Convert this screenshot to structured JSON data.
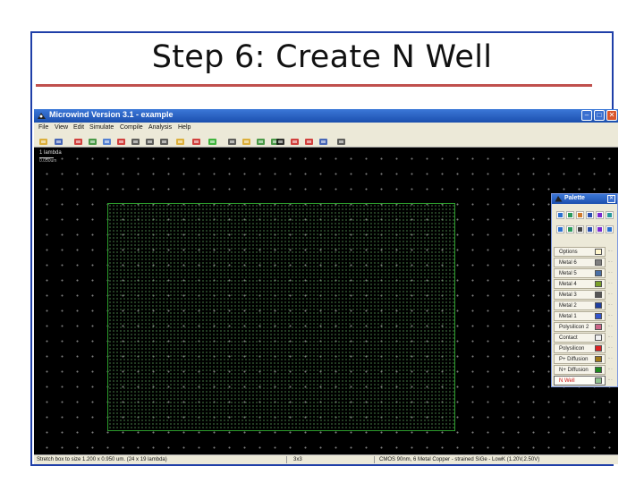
{
  "slide": {
    "title": "Step 6: Create N Well"
  },
  "app": {
    "window_title": "Microwind Version 3.1 - example",
    "menu": [
      "File",
      "View",
      "Edit",
      "Simulate",
      "Compile",
      "Analysis",
      "Help"
    ],
    "toolbar_icons": [
      {
        "name": "open-folder-icon",
        "color": "#d9a520"
      },
      {
        "name": "save-icon",
        "color": "#2a4fb0"
      },
      {
        "name": "draw-box-icon",
        "color": "#cc2222"
      },
      {
        "name": "stretch-icon",
        "color": "#2e8b2e"
      },
      {
        "name": "copy-icon",
        "color": "#3a6fd0"
      },
      {
        "name": "cut-icon",
        "color": "#cc2222"
      },
      {
        "name": "zoom-in-icon",
        "color": "#444444"
      },
      {
        "name": "zoom-out-icon",
        "color": "#444444"
      },
      {
        "name": "zoom-fit-icon",
        "color": "#444444"
      },
      {
        "name": "view-cross-section-icon",
        "color": "#d9a520"
      },
      {
        "name": "measure-icon",
        "color": "#cc2222"
      },
      {
        "name": "run-simulation-icon",
        "color": "#22aa22"
      },
      {
        "name": "connection-icon",
        "color": "#444444"
      },
      {
        "name": "key-icon",
        "color": "#d9a520"
      },
      {
        "name": "library-icon",
        "color": "#2e8b2e"
      },
      {
        "name": "process-3d-icon",
        "color": "#2e8b2e"
      },
      {
        "name": "lambda-icon",
        "color": "#111111"
      },
      {
        "name": "text-icon",
        "color": "#cc2222"
      },
      {
        "name": "chart-icon",
        "color": "#cc2222"
      },
      {
        "name": "graph-icon",
        "color": "#2a4fb0"
      },
      {
        "name": "arrows-icon",
        "color": "#444444"
      }
    ],
    "scale": {
      "label": "1 lambda",
      "sub": "0.050um"
    },
    "palette": {
      "title": "Palette",
      "layers": [
        {
          "label": "Options",
          "color": "#fff6cc",
          "selected": false,
          "red": false
        },
        {
          "label": "Metal 6",
          "color": "#7f7f7f",
          "selected": false,
          "red": false
        },
        {
          "label": "Metal 5",
          "color": "#4a6fa5",
          "selected": false,
          "red": false
        },
        {
          "label": "Metal 4",
          "color": "#7aa02a",
          "selected": false,
          "red": false
        },
        {
          "label": "Metal 3",
          "color": "#555555",
          "selected": false,
          "red": false
        },
        {
          "label": "Metal 2",
          "color": "#1f3f9f",
          "selected": false,
          "red": false
        },
        {
          "label": "Metal 1",
          "color": "#3355cc",
          "selected": false,
          "red": false
        },
        {
          "label": "Polysilicon 2",
          "color": "#cc6688",
          "selected": false,
          "red": false
        },
        {
          "label": "Contact",
          "color": "#f0f0f0",
          "selected": false,
          "red": false
        },
        {
          "label": "Polysilicon",
          "color": "#dd2222",
          "selected": false,
          "red": false
        },
        {
          "label": "P+ Diffusion",
          "color": "#a07a1a",
          "selected": false,
          "red": false
        },
        {
          "label": "N+ Diffusion",
          "color": "#1e8a1e",
          "selected": false,
          "red": false
        },
        {
          "label": "N Well",
          "color": "#8fc28f",
          "selected": true,
          "red": true
        }
      ]
    },
    "status": {
      "left": "Stretch box to size 1.200 x 0.950 um. (24 x 19 lambda)",
      "middle": "3x3",
      "right": "CMOS 90nm, 6 Metal Copper - strained SiGe - LowK (1.20V,2.50V)"
    }
  }
}
